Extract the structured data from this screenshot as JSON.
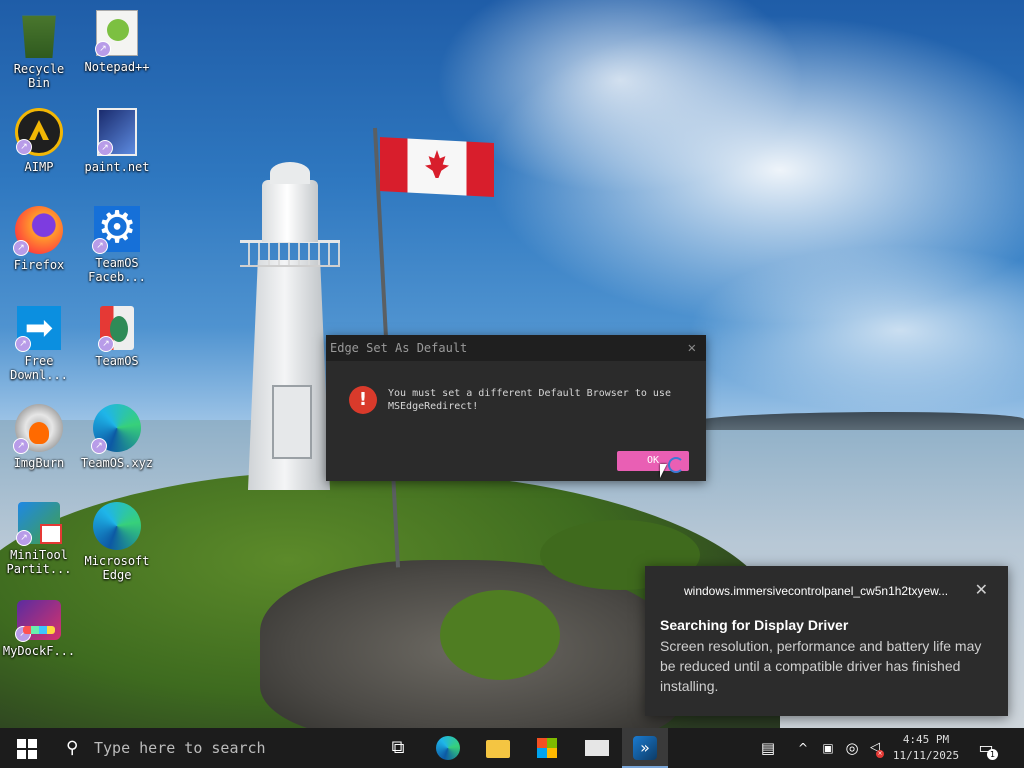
{
  "desktop": {
    "icons": [
      {
        "label": "Recycle Bin",
        "icon": "recycle-bin-icon"
      },
      {
        "label": "Notepad++",
        "icon": "notepadpp-icon"
      },
      {
        "label": "AIMP",
        "icon": "aimp-icon"
      },
      {
        "label": "paint.net",
        "icon": "paintnet-icon"
      },
      {
        "label": "Firefox",
        "icon": "firefox-icon"
      },
      {
        "label": "TeamOS Faceb...",
        "icon": "gear-icon"
      },
      {
        "label": "Free Downl...",
        "icon": "free-download-manager-icon"
      },
      {
        "label": "TeamOS",
        "icon": "teamos-icon"
      },
      {
        "label": "ImgBurn",
        "icon": "imgburn-icon"
      },
      {
        "label": "TeamOS.xyz",
        "icon": "edge-icon"
      },
      {
        "label": "MiniTool Partit...",
        "icon": "minitool-icon"
      },
      {
        "label": "Microsoft Edge",
        "icon": "edge-icon"
      },
      {
        "label": "MyDockF...",
        "icon": "mydock-icon"
      }
    ]
  },
  "dialog": {
    "title": "Edge Set As Default",
    "message": "You must set a different Default Browser to use MSEdgeRedirect!",
    "ok_label": "OK",
    "close_glyph": "✕"
  },
  "toast": {
    "app_name": "windows.immersivecontrolpanel_cw5n1h2txyew...",
    "title": "Searching for Display Driver",
    "body": "Screen resolution, performance and battery life may be reduced until a compatible driver has finished installing.",
    "close_glyph": "✕"
  },
  "taskbar": {
    "search_placeholder": "Type here to search",
    "time": "4:45 PM",
    "date": "11/11/2025",
    "notification_count": "1",
    "redirect_glyph": "»"
  },
  "colors": {
    "ok_button": "#e95fb4",
    "error_icon": "#d93a2b",
    "taskbar": "#1c1c1c",
    "toast_bg": "#2c2c2c"
  }
}
